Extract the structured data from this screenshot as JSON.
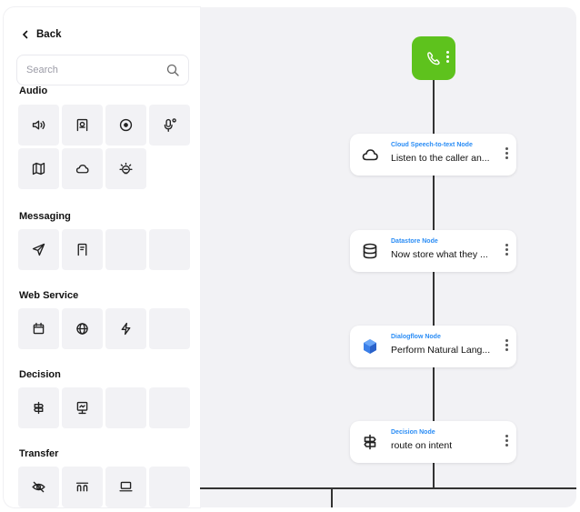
{
  "sidebar": {
    "back_label": "Back",
    "search_placeholder": "Search",
    "sections": [
      {
        "title": "Audio",
        "icons": [
          "speaker-icon",
          "audio-device-icon",
          "record-icon",
          "mic-settings-icon",
          "map-icon",
          "cloud-icon",
          "brain-bulb-icon"
        ]
      },
      {
        "title": "Messaging",
        "icons": [
          "send-icon",
          "message-card-icon",
          "empty",
          "empty"
        ]
      },
      {
        "title": "Web Service",
        "icons": [
          "calendar-icon",
          "globe-icon",
          "webhook-icon",
          "empty"
        ]
      },
      {
        "title": "Decision",
        "icons": [
          "signpost-icon",
          "kiosk-icon",
          "empty",
          "empty"
        ]
      },
      {
        "title": "Transfer",
        "icons": [
          "eye-off-icon",
          "transfer-bridge-icon",
          "laptop-icon",
          "empty"
        ]
      }
    ]
  },
  "canvas": {
    "start_node": {
      "icon": "phone-icon",
      "color": "#5ec21d"
    },
    "nodes": [
      {
        "type": "Cloud Speech-to-text Node",
        "label": "Listen to the caller an...",
        "icon": "cloud-icon"
      },
      {
        "type": "Datastore Node",
        "label": "Now store what they ...",
        "icon": "database-icon"
      },
      {
        "type": "Dialogflow Node",
        "label": "Perform Natural Lang...",
        "icon": "dialogflow-icon"
      },
      {
        "type": "Decision Node",
        "label": "route on intent",
        "icon": "signpost-icon"
      }
    ]
  },
  "colors": {
    "accent_blue": "#2b8df5",
    "start_green": "#5ec21d",
    "canvas_bg": "#f2f2f5",
    "tile_bg": "#f2f2f5"
  }
}
